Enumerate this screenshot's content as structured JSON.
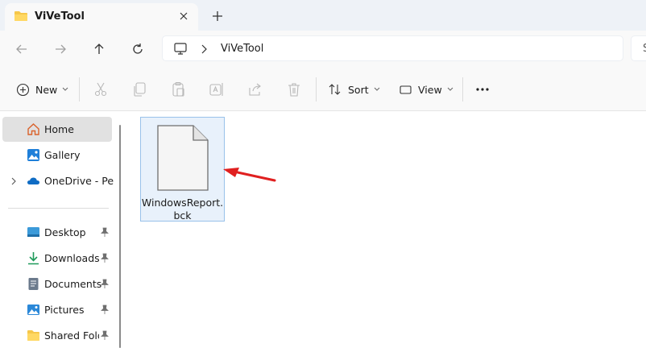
{
  "tab": {
    "title": "ViVeTool",
    "folder_icon": "folder-icon",
    "close_icon": "close-icon",
    "new_tab_icon": "plus-icon"
  },
  "nav": {
    "back_icon": "arrow-left-icon",
    "forward_icon": "arrow-right-icon",
    "up_icon": "arrow-up-icon",
    "refresh_icon": "refresh-icon"
  },
  "address": {
    "location_icon": "this-pc-icon",
    "separator_icon": "chevron-right-icon",
    "path": "ViVeTool"
  },
  "search": {
    "placeholder": "S"
  },
  "commands": {
    "new_label": "New",
    "sort_label": "Sort",
    "view_label": "View",
    "more_icon": "ellipsis-icon",
    "disabled_icons": [
      "cut-icon",
      "copy-icon",
      "paste-icon",
      "rename-icon",
      "share-icon",
      "delete-icon"
    ]
  },
  "sidebar": {
    "items": [
      {
        "label": "Home",
        "icon": "home-icon",
        "selected": true
      },
      {
        "label": "Gallery",
        "icon": "gallery-icon"
      },
      {
        "label": "OneDrive - Perso",
        "icon": "onedrive-icon",
        "expandable": true
      }
    ],
    "quick_access": [
      {
        "label": "Desktop",
        "icon": "desktop-icon",
        "pinned": true
      },
      {
        "label": "Downloads",
        "icon": "downloads-icon",
        "pinned": true
      },
      {
        "label": "Documents",
        "icon": "documents-icon",
        "pinned": true
      },
      {
        "label": "Pictures",
        "icon": "pictures-icon",
        "pinned": true
      },
      {
        "label": "Shared Folde",
        "icon": "shared-folder-icon",
        "pinned": true
      }
    ]
  },
  "files": [
    {
      "name": "WindowsReport.bck",
      "icon": "blank-file-icon",
      "selected": true
    }
  ],
  "annotation": {
    "icon": "red-arrow-icon",
    "color": "#e02020"
  }
}
